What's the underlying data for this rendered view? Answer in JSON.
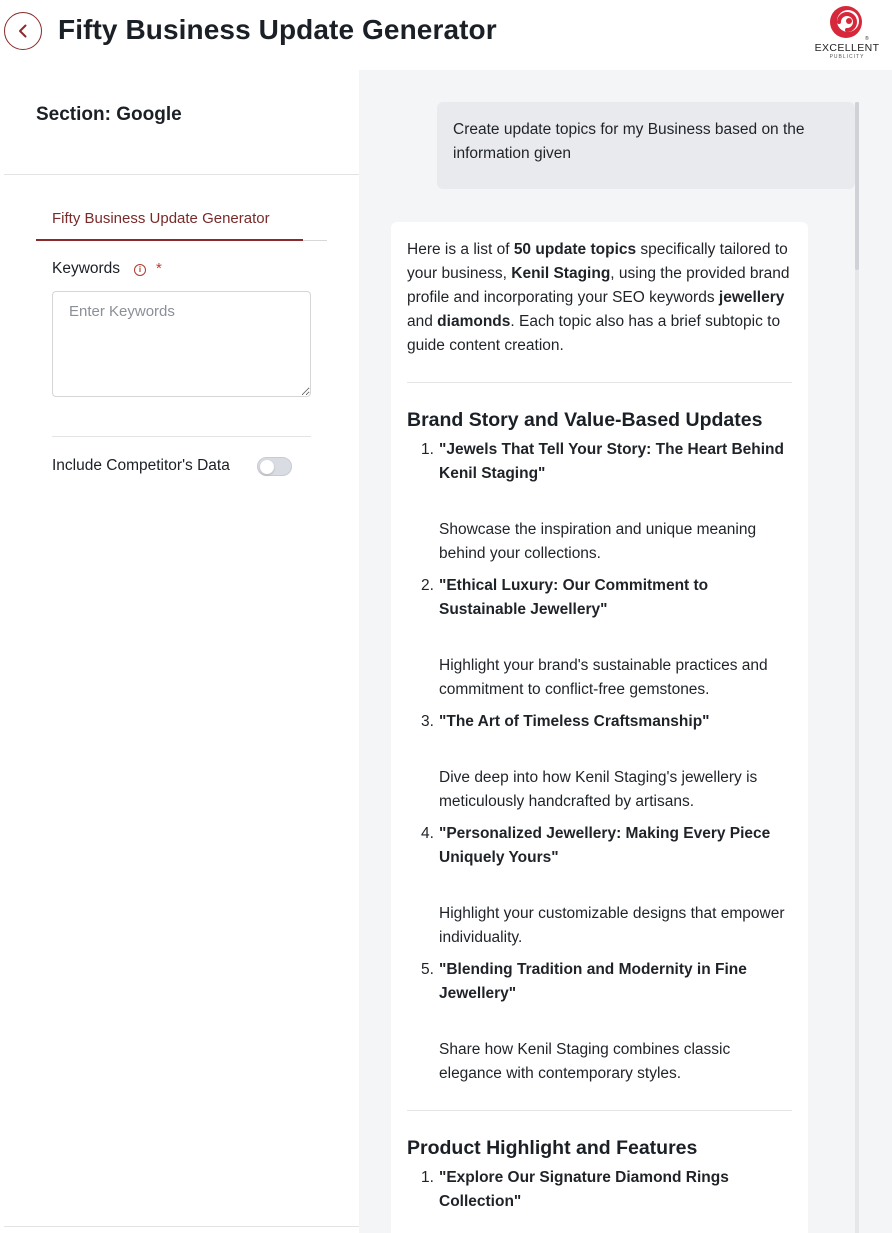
{
  "header": {
    "title": "Fifty Business Update Generator",
    "logo_text": "EXCELLENT",
    "logo_sub": "PUBLICITY"
  },
  "left": {
    "section_title": "Section: Google",
    "tab_label": "Fifty Business Update Generator",
    "keywords_label": "Keywords",
    "required_mark": "*",
    "keywords_placeholder": "Enter Keywords",
    "keywords_value": "",
    "competitor_label": "Include Competitor's Data",
    "competitor_enabled": false
  },
  "chat": {
    "user_message": "Create update topics for my Business based on the information given",
    "response": {
      "intro_parts": [
        {
          "text": "Here is a list of ",
          "bold": false
        },
        {
          "text": "50 update topics",
          "bold": true
        },
        {
          "text": " specifically tailored to your business, ",
          "bold": false
        },
        {
          "text": "Kenil Staging",
          "bold": true
        },
        {
          "text": ", using the provided brand profile and incorporating your SEO keywords ",
          "bold": false
        },
        {
          "text": "jewellery",
          "bold": true
        },
        {
          "text": " and ",
          "bold": false
        },
        {
          "text": "diamonds",
          "bold": true
        },
        {
          "text": ". Each topic also has a brief subtopic to guide content creation.",
          "bold": false
        }
      ],
      "categories": [
        {
          "heading": "Brand Story and Value-Based Updates",
          "topics": [
            {
              "num": "1.",
              "title": "\"Jewels That Tell Your Story: The Heart Behind Kenil Staging\"",
              "desc": "Showcase the inspiration and unique meaning behind your collections."
            },
            {
              "num": "2.",
              "title": "\"Ethical Luxury: Our Commitment to Sustainable Jewellery\"",
              "desc": "Highlight your brand's sustainable practices and commitment to conflict-free gemstones."
            },
            {
              "num": "3.",
              "title": "\"The Art of Timeless Craftsmanship\"",
              "desc": "Dive deep into how Kenil Staging's jewellery is meticulously handcrafted by artisans."
            },
            {
              "num": "4.",
              "title": "\"Personalized Jewellery: Making Every Piece Uniquely Yours\"",
              "desc": "Highlight your customizable designs that empower individuality."
            },
            {
              "num": "5.",
              "title": "\"Blending Tradition and Modernity in Fine Jewellery\"",
              "desc": "Share how Kenil Staging combines classic elegance with contemporary styles."
            }
          ]
        },
        {
          "heading": "Product Highlight and Features",
          "topics": [
            {
              "num": "1.",
              "title": "\"Explore Our Signature Diamond Rings Collection\"",
              "desc": ""
            }
          ]
        }
      ]
    }
  },
  "colors": {
    "accent": "#8a2a2a",
    "required": "#c0392b",
    "panel_bg": "#f4f5f7",
    "bubble_bg": "#e8eaee"
  }
}
